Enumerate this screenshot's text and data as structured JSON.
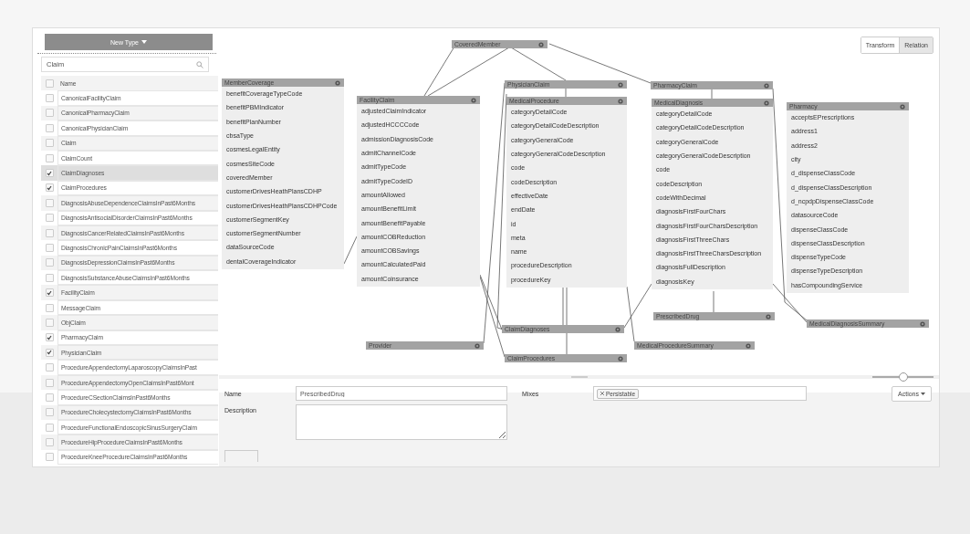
{
  "new_type_button": "New Type",
  "search": {
    "value": "Claim"
  },
  "types_table": {
    "header": "Name",
    "header_checked": false,
    "rows": [
      {
        "name": "CanonicalFacilityClaim",
        "checked": false,
        "selected": false
      },
      {
        "name": "CanonicalPharmacyClaim",
        "checked": false,
        "selected": false
      },
      {
        "name": "CanonicalPhysicianClaim",
        "checked": false,
        "selected": false
      },
      {
        "name": "Claim",
        "checked": false,
        "selected": false
      },
      {
        "name": "ClaimCount",
        "checked": false,
        "selected": false
      },
      {
        "name": "ClaimDiagnoses",
        "checked": true,
        "selected": true
      },
      {
        "name": "ClaimProcedures",
        "checked": true,
        "selected": false
      },
      {
        "name": "DiagnosisAbuseDependenceClaimsInPast6Months",
        "checked": false,
        "selected": false
      },
      {
        "name": "DiagnosisAntisocialDisorderClaimsInPast6Months",
        "checked": false,
        "selected": false
      },
      {
        "name": "DiagnosisCancerRelatedClaimsInPast6Months",
        "checked": false,
        "selected": false
      },
      {
        "name": "DiagnosisChronicPainClaimsInPast6Months",
        "checked": false,
        "selected": false
      },
      {
        "name": "DiagnosisDepressionClaimsInPast6Months",
        "checked": false,
        "selected": false
      },
      {
        "name": "DiagnosisSubstanceAbuseClaimsInPast6Months",
        "checked": false,
        "selected": false
      },
      {
        "name": "FacilityClaim",
        "checked": true,
        "selected": false
      },
      {
        "name": "MessageClaim",
        "checked": false,
        "selected": false
      },
      {
        "name": "ObjClaim",
        "checked": false,
        "selected": false
      },
      {
        "name": "PharmacyClaim",
        "checked": true,
        "selected": false
      },
      {
        "name": "PhysicianClaim",
        "checked": true,
        "selected": false
      },
      {
        "name": "ProcedureAppendectomyLaparoscopyClaimsInPast",
        "checked": false,
        "selected": false
      },
      {
        "name": "ProcedureAppendectomyOpenClaimsInPast6Mont",
        "checked": false,
        "selected": false
      },
      {
        "name": "ProcedureCSectionClaimsInPast6Months",
        "checked": false,
        "selected": false
      },
      {
        "name": "ProcedureCholecystectomyClaimsInPast6Months",
        "checked": false,
        "selected": false
      },
      {
        "name": "ProcedureFunctionalEndoscopicSinusSurgeryClaim",
        "checked": false,
        "selected": false
      },
      {
        "name": "ProcedureHipProcedureClaimsInPast6Months",
        "checked": false,
        "selected": false
      },
      {
        "name": "ProcedureKneeProcedureClaimsInPast6Months",
        "checked": false,
        "selected": false
      }
    ]
  },
  "view_toggle": [
    {
      "label": "Transform",
      "selected": false
    },
    {
      "label": "Relation",
      "selected": true
    }
  ],
  "diagram": {
    "nodes": [
      {
        "title": "CoveredMember"
      },
      {
        "title": "MemberCoverage",
        "fields": [
          "benefitCoverageTypeCode",
          "benefitPBMIndicator",
          "benefitPlanNumber",
          "cbsaType",
          "cosmesLegalEntity",
          "cosmesSiteCode",
          "coveredMember",
          "customerDrivesHeathPlansCDHP",
          "customerDrivesHeathPlansCDHPCode",
          "customerSegmentKey",
          "customerSegmentNumber",
          "dataSourceCode",
          "dentalCoverageIndicator"
        ]
      },
      {
        "title": "FacilityClaim",
        "fields": [
          "adjustedClaimIndicator",
          "adjustedHCCCCode",
          "admissionDiagnosisCode",
          "admitChannelCode",
          "admitTypeCode",
          "admitTypeCodeID",
          "amountAllowed",
          "amountBenefitLimit",
          "amountBenefitPayable",
          "amountCOBReduction",
          "amountCOBSavings",
          "amountCalculatedPaid",
          "amountCoinsurance"
        ]
      },
      {
        "title": "PhysicianClaim"
      },
      {
        "title": "MedicalProcedure",
        "fields": [
          "categoryDetailCode",
          "categoryDetailCodeDescription",
          "categoryGeneralCode",
          "categoryGeneralCodeDescription",
          "code",
          "codeDescription",
          "effectiveDate",
          "endDate",
          "id",
          "meta",
          "name",
          "procedureDescription",
          "procedureKey"
        ]
      },
      {
        "title": "PharmacyClaim"
      },
      {
        "title": "MedicalDiagnosis",
        "fields": [
          "categoryDetailCode",
          "categoryDetailCodeDescription",
          "categoryGeneralCode",
          "categoryGeneralCodeDescription",
          "code",
          "codeDescription",
          "codeWithDecimal",
          "diagnosisFirstFourChars",
          "diagnosisFirstFourCharsDescription",
          "diagnosisFirstThreeChars",
          "diagnosisFirstThreeCharsDescription",
          "diagnosisFullDescription",
          "diagnosisKey"
        ]
      },
      {
        "title": "Pharmacy",
        "fields": [
          "acceptsEPrescriptions",
          "address1",
          "address2",
          "city",
          "d_dispenseClassCode",
          "d_dispenseClassDescription",
          "d_ncpdpDispenseClassCode",
          "datasourceCode",
          "dispenseClassCode",
          "dispenseClassDescription",
          "dispenseTypeCode",
          "dispenseTypeDescription",
          "hasCompoundingService"
        ]
      },
      {
        "title": "PrescribedDrug"
      },
      {
        "title": "MedicalDiagnosisSummary"
      },
      {
        "title": "ClaimDiagnoses"
      },
      {
        "title": "Provider"
      },
      {
        "title": "MedicalProcedureSummary"
      },
      {
        "title": "ClaimProcedures"
      }
    ]
  },
  "zoom_slider": {
    "level": 0.5
  },
  "form": {
    "name_label": "Name",
    "name_value": "PrescribedDrug",
    "description_label": "Description",
    "mixes_label": "Mixes",
    "mixes_tags": [
      "Persistable"
    ],
    "actions_button": "Actions"
  }
}
